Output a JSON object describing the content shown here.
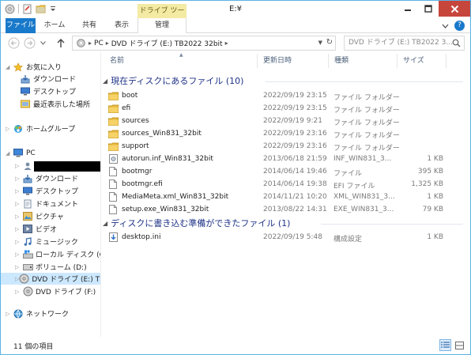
{
  "window": {
    "title": "E:¥",
    "contextual_tab_group": "ドライブ ツール"
  },
  "ribbon": {
    "tabs": [
      "ファイル",
      "ホーム",
      "共有",
      "表示",
      "管理"
    ]
  },
  "address": {
    "crumbs": [
      "PC",
      "DVD ドライブ (E:) TB2022 32bit"
    ],
    "search_placeholder": "DVD ドライブ (E:) TB2022 3..."
  },
  "nav": {
    "favorites": "お気に入り",
    "downloads": "ダウンロード",
    "desktop": "デスクトップ",
    "recent": "最近表示した場所",
    "homegroup": "ホームグループ",
    "pc": "PC",
    "pc_items": [
      "ダウンロード",
      "デスクトップ",
      "ドキュメント",
      "ピクチャ",
      "ビデオ",
      "ミュージック",
      "ローカル ディスク (C:)",
      "ボリューム (D:)",
      "DVD ドライブ (E:) TB",
      "DVD ドライブ (F:)"
    ],
    "network": "ネットワーク"
  },
  "columns": {
    "name": "名前",
    "date": "更新日時",
    "type": "種類",
    "size": "サイズ"
  },
  "groups": [
    {
      "title": "現在ディスクにあるファイル (10)",
      "rows": [
        {
          "icon": "folder-icon",
          "name": "boot",
          "date": "2022/09/19 23:15",
          "type": "ファイル フォルダー",
          "size": ""
        },
        {
          "icon": "folder-icon",
          "name": "efi",
          "date": "2022/09/19 23:15",
          "type": "ファイル フォルダー",
          "size": ""
        },
        {
          "icon": "folder-icon",
          "name": "sources",
          "date": "2022/09/19 9:21",
          "type": "ファイル フォルダー",
          "size": ""
        },
        {
          "icon": "folder-icon",
          "name": "sources_Win831_32bit",
          "date": "2022/09/19 23:16",
          "type": "ファイル フォルダー",
          "size": ""
        },
        {
          "icon": "folder-icon",
          "name": "support",
          "date": "2022/09/19 23:16",
          "type": "ファイル フォルダー",
          "size": ""
        },
        {
          "icon": "settings-file-icon",
          "name": "autorun.inf_Win831_32bit",
          "date": "2013/06/18 21:59",
          "type": "INF_WIN831_3...",
          "size": "1 KB"
        },
        {
          "icon": "file-icon",
          "name": "bootmgr",
          "date": "2014/06/14 19:46",
          "type": "ファイル",
          "size": "395 KB"
        },
        {
          "icon": "file-icon",
          "name": "bootmgr.efi",
          "date": "2014/06/14 19:38",
          "type": "EFI ファイル",
          "size": "1,325 KB"
        },
        {
          "icon": "file-icon",
          "name": "MediaMeta.xml_Win831_32bit",
          "date": "2014/11/21 10:20",
          "type": "XML_WIN831_3...",
          "size": "1 KB"
        },
        {
          "icon": "file-icon",
          "name": "setup.exe_Win831_32bit",
          "date": "2013/08/22 14:31",
          "type": "EXE_WIN831_3...",
          "size": "79 KB"
        }
      ]
    },
    {
      "title": "ディスクに書き込む準備ができたファイル (1)",
      "rows": [
        {
          "icon": "pending-write-file-icon",
          "name": "desktop.ini",
          "date": "2022/09/19 5:48",
          "type": "構成設定",
          "size": "1 KB"
        }
      ]
    }
  ],
  "status": {
    "item_count": "11 個の項目"
  },
  "colors": {
    "accent": "#1979ca",
    "group_header": "#1e3287",
    "selection": "#cce8ff",
    "contextual": "#f3eaa4",
    "close": "#c7463c"
  }
}
